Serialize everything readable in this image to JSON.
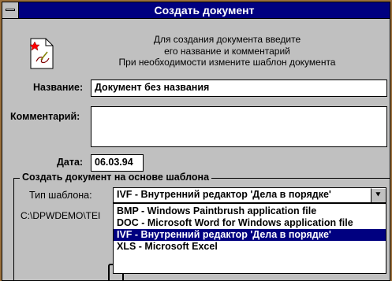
{
  "dialog": {
    "title": "Создать документ",
    "intro": {
      "line1": "Для создания документа введите",
      "line2": "его название и комментарий",
      "line3": "При необходимости измените шаблон документа"
    }
  },
  "form": {
    "name_label": "Название:",
    "name_value": "Документ без названия",
    "comment_label": "Комментарий:",
    "comment_value": "",
    "date_label": "Дата:",
    "date_value": "06.03.94"
  },
  "template_group": {
    "title": "Создать документ на основе шаблона",
    "type_label": "Тип шаблона:",
    "selected": "IVF - Внутренний редактор 'Дела в порядке'",
    "path": "C:\\DPWDEMO\\TEI",
    "options": [
      "BMP - Windows Paintbrush application file",
      "DOC - Microsoft Word for Windows application file",
      "IVF - Внутренний редактор 'Дела в порядке'",
      "XLS - Microsoft Excel"
    ],
    "highlighted_index": 2,
    "dropdown_arrow": "⯆"
  },
  "icons": {
    "system_menu": "system-menu-icon",
    "document": "document-icon"
  },
  "colors": {
    "title_bar": "#000080",
    "dialog_bg": "#c0c0c0",
    "selection": "#000080",
    "desktop": "#9a6f3c"
  }
}
